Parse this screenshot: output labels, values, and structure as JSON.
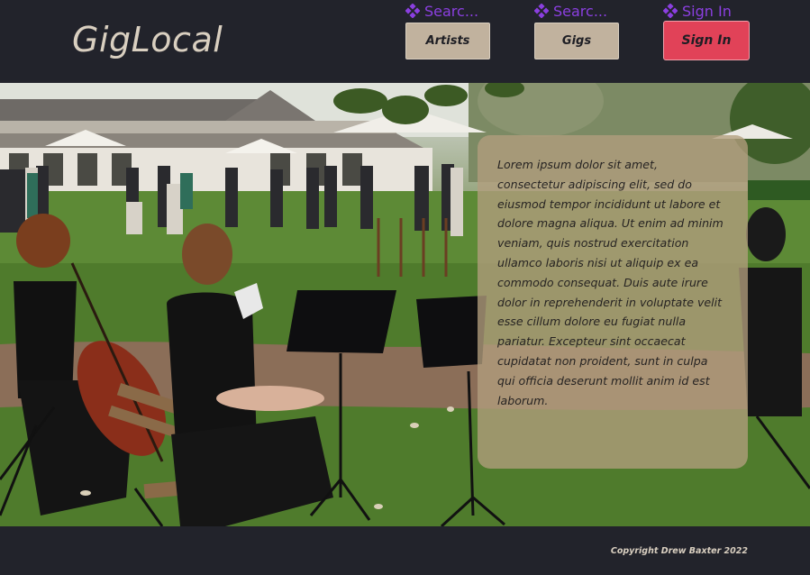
{
  "header": {
    "logo": "GigLocal",
    "nav": [
      {
        "link_label": "Searc...",
        "link_icon": "diamond-icon",
        "button_label": "Artists"
      },
      {
        "link_label": "Searc...",
        "link_icon": "diamond-icon",
        "button_label": "Gigs"
      },
      {
        "link_label": "Sign In",
        "link_icon": "diamond-icon",
        "button_label": "Sign In"
      }
    ]
  },
  "hero": {
    "image_subject": "string quartet playing outdoors on a lawn at a garden party",
    "card_text": "Lorem ipsum dolor sit amet, consectetur adipiscing elit, sed do eiusmod tempor incididunt ut labore et dolore magna aliqua. Ut enim ad minim veniam, quis nostrud exercitation ullamco laboris nisi ut aliquip ex ea commodo consequat. Duis aute irure dolor in reprehenderit in voluptate velit esse cillum dolore eu fugiat nulla pariatur. Excepteur sint occaecat cupidatat non proident, sunt in culpa qui officia deserunt mollit anim id est laborum."
  },
  "footer": {
    "copyright": "Copyright Drew Baxter 2022"
  },
  "colors": {
    "background": "#22232b",
    "logo": "#d9cfc0",
    "nav_link": "#8b3fe0",
    "button": "#c1b29e",
    "signin_button": "#e14258",
    "card_overlay": "#b29e7e"
  }
}
